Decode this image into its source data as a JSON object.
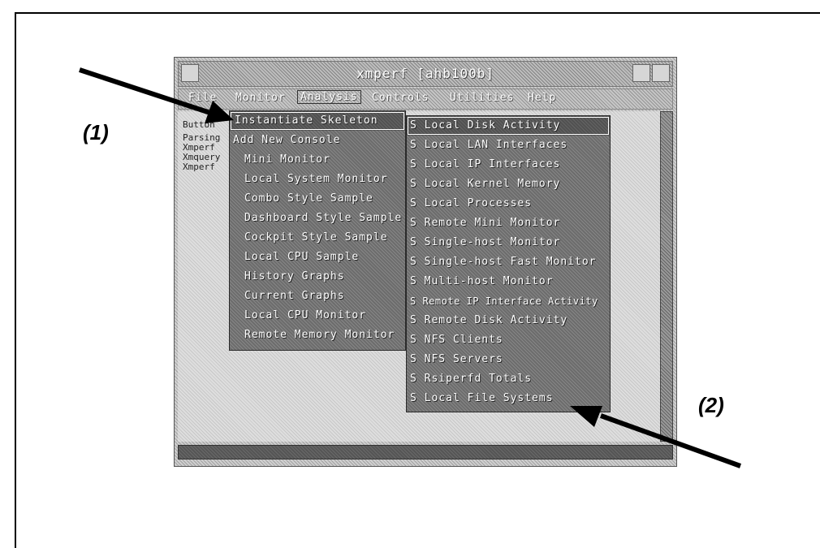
{
  "callouts": {
    "one": "(1)",
    "two": "(2)"
  },
  "window": {
    "title": "xmperf [ahb100b]"
  },
  "menubar": {
    "items": [
      "File",
      "Monitor",
      "Analysis",
      "Controls",
      "Utilities",
      "Help"
    ],
    "active": "Analysis"
  },
  "list": [
    "Button",
    "Parsing",
    "Xmperf",
    "Xmquery",
    "Xmperf"
  ],
  "main_menu": {
    "items": [
      "Instantiate Skeleton",
      "Add New Console",
      "Mini Monitor",
      "Local System Monitor",
      "Combo Style Sample",
      "Dashboard Style Sample",
      "Cockpit Style Sample",
      "Local CPU Sample",
      "History Graphs",
      "Current Graphs",
      "Local CPU Monitor",
      "Remote Memory Monitor"
    ],
    "highlighted": "Instantiate Skeleton"
  },
  "sub_menu": {
    "items": [
      "S Local Disk Activity",
      "S Local LAN Interfaces",
      "S Local IP Interfaces",
      "S Local Kernel Memory",
      "S Local Processes",
      "S Remote Mini Monitor",
      "S Single-host Monitor",
      "S Single-host Fast Monitor",
      "S Multi-host Monitor",
      "S Remote IP Interface Activity",
      "S Remote Disk Activity",
      "S NFS Clients",
      "S NFS Servers",
      "S Rsiperfd Totals",
      "S Local File Systems"
    ],
    "highlighted": "S Local Disk Activity"
  },
  "colors": {
    "menu_bg": "#6c6c6c",
    "window_bg": "#cfcfcf",
    "text_light": "#ffffff"
  }
}
